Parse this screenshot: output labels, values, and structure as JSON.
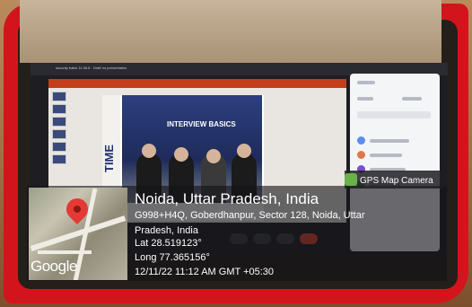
{
  "screen": {
    "title": "security bakis 11.06.8 · Draft no presentation"
  },
  "slide": {
    "side_text": "TIME",
    "title": "INTERVIEW BASICS"
  },
  "overlay": {
    "location_title": "Noida, Uttar Pradesh, India",
    "address_line1": "G998+H4Q, Goberdhanpur, Sector 128, Noida, Uttar",
    "address_line2": "Pradesh, India",
    "latitude": "Lat 28.519123°",
    "longitude": "Long 77.365156°",
    "timestamp": "12/11/22 11:12 AM GMT +05:30",
    "map_brand": "Google",
    "app_tag": "GPS Map Camera"
  },
  "colors": {
    "frame": "#d4141c",
    "pin": "#e53935"
  }
}
